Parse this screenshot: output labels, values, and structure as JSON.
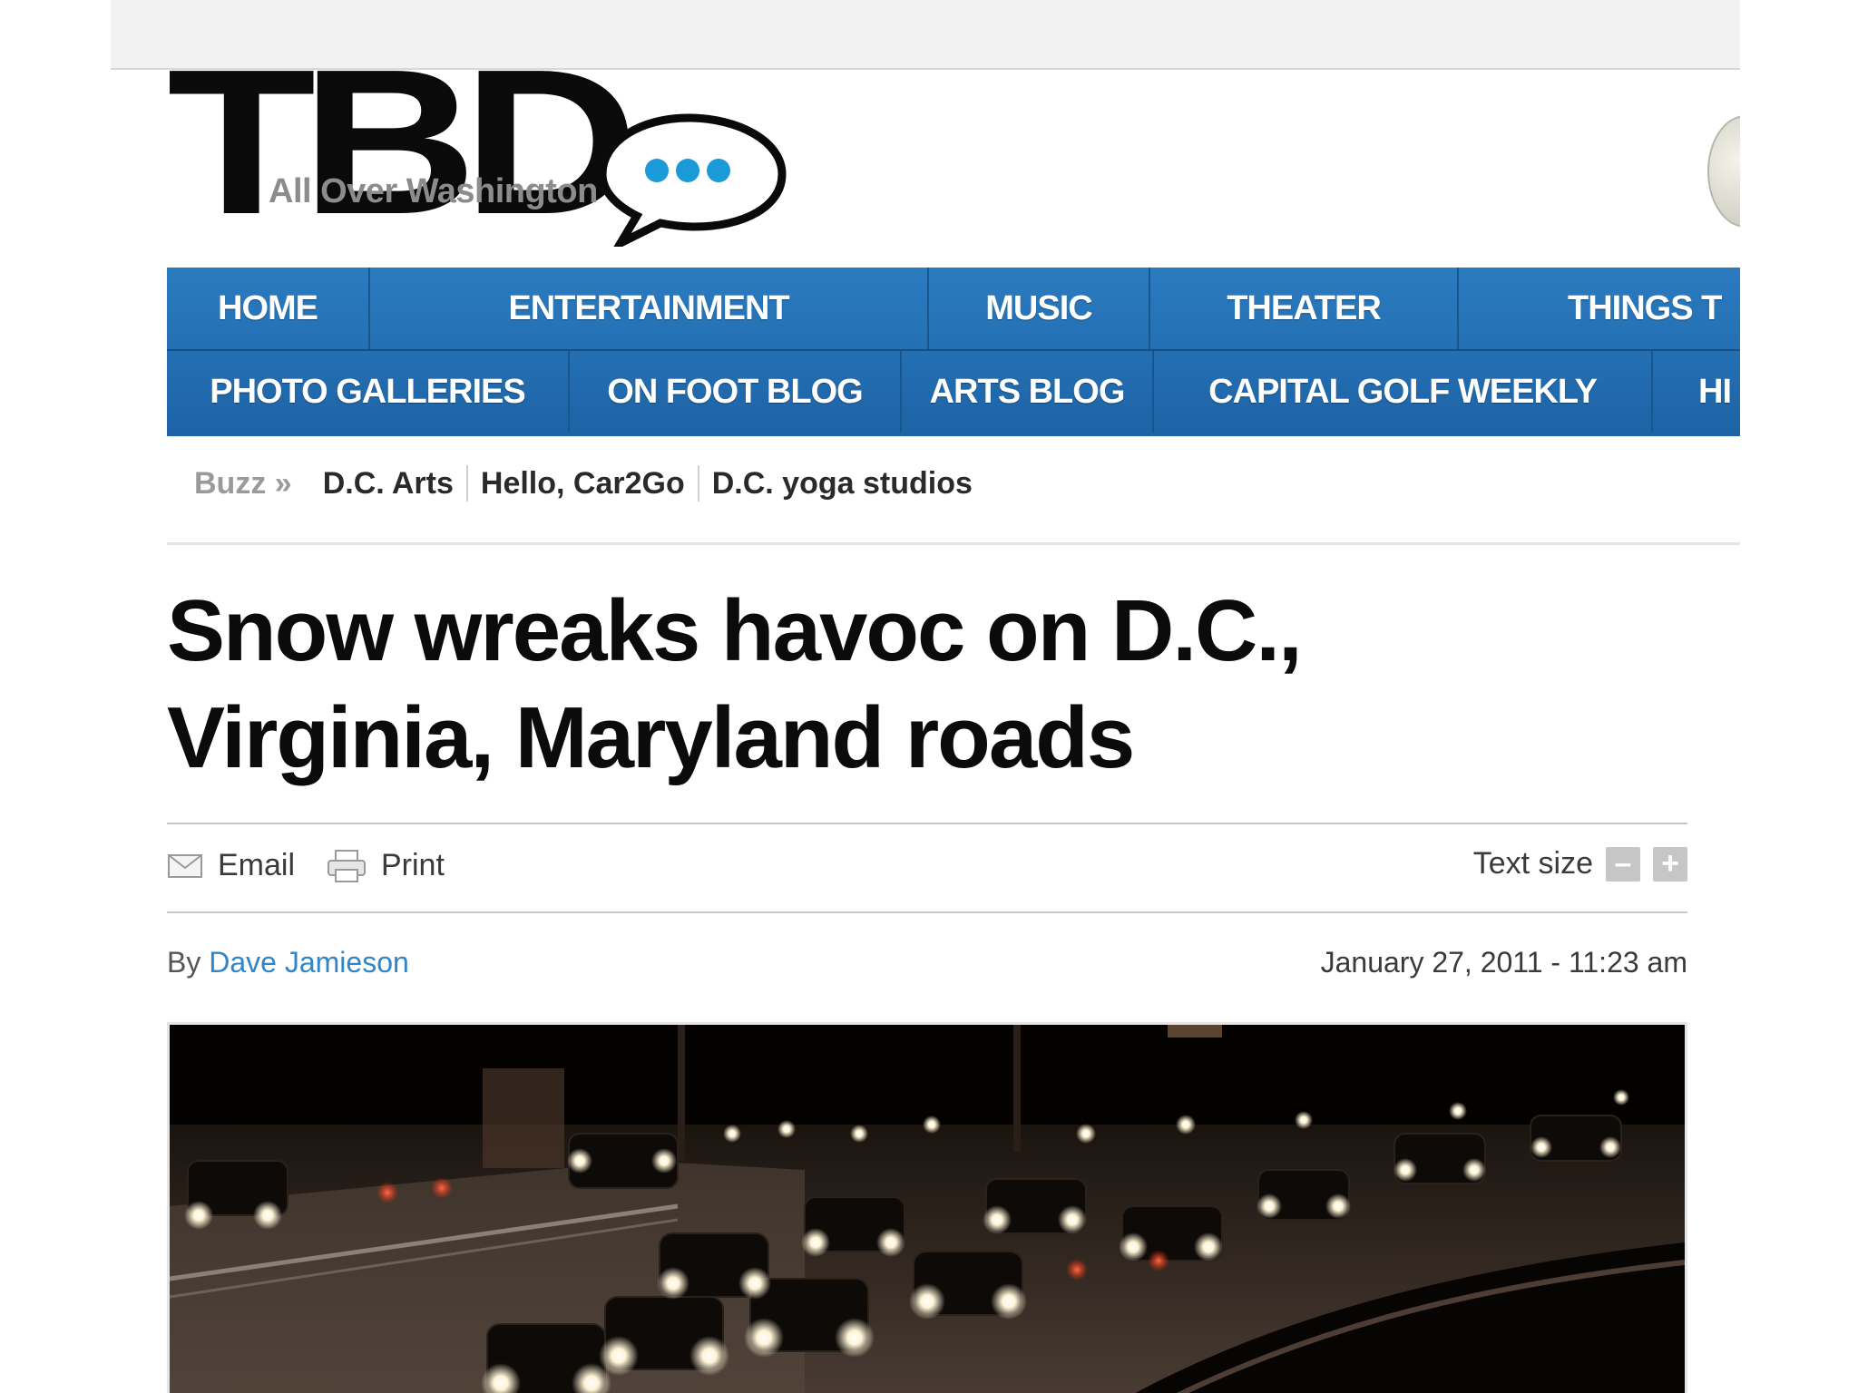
{
  "logo": {
    "wordmark": "TBD",
    "tagline": "All Over Washington",
    "bubble_color": "#1a9ad6"
  },
  "nav": {
    "row1": [
      "HOME",
      "ENTERTAINMENT",
      "MUSIC",
      "THEATER",
      "THINGS T"
    ],
    "row2": [
      "PHOTO GALLERIES",
      "ON FOOT BLOG",
      "ARTS BLOG",
      "CAPITAL GOLF WEEKLY",
      "HI"
    ],
    "background": "#2370b3"
  },
  "breadcrumbs": {
    "label": "Buzz »",
    "links": [
      "D.C. Arts",
      "Hello, Car2Go",
      "D.C. yoga studios"
    ]
  },
  "article": {
    "headline_line1": "Snow wreaks havoc on D.C.,",
    "headline_line2": "Virginia, Maryland roads",
    "byline_prefix": "By",
    "author": "Dave Jamieson",
    "date": "January 27, 2011 - 11:23 am"
  },
  "toolbar": {
    "email_label": "Email",
    "print_label": "Print",
    "text_size_label": "Text size",
    "decrease": "–",
    "increase": "+"
  },
  "colors": {
    "link": "#2f86c8",
    "nav_blue": "#2370b3"
  }
}
